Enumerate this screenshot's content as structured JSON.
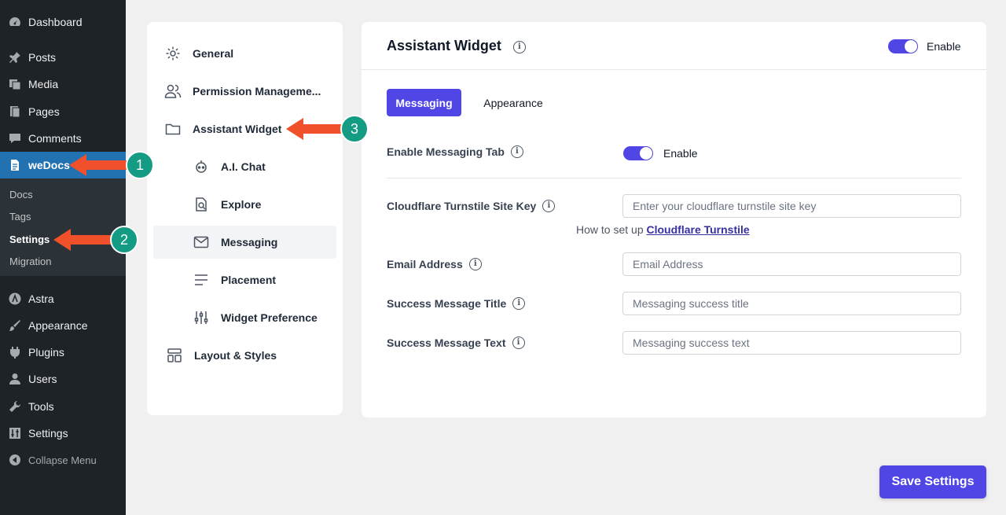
{
  "wp_menu": {
    "items": [
      {
        "label": "Dashboard",
        "icon": "dashboard-icon"
      },
      {
        "label": "Posts",
        "icon": "pin-icon"
      },
      {
        "label": "Media",
        "icon": "media-icon"
      },
      {
        "label": "Pages",
        "icon": "pages-icon"
      },
      {
        "label": "Comments",
        "icon": "comment-icon"
      },
      {
        "label": "weDocs",
        "icon": "document-icon"
      },
      {
        "label": "Astra",
        "icon": "astra-icon"
      },
      {
        "label": "Appearance",
        "icon": "brush-icon"
      },
      {
        "label": "Plugins",
        "icon": "plug-icon"
      },
      {
        "label": "Users",
        "icon": "user-icon"
      },
      {
        "label": "Tools",
        "icon": "wrench-icon"
      },
      {
        "label": "Settings",
        "icon": "sliders-icon"
      },
      {
        "label": "Collapse Menu",
        "icon": "collapse-icon"
      }
    ],
    "submenu": [
      "Docs",
      "Tags",
      "Settings",
      "Migration"
    ]
  },
  "settings_nav": {
    "items": [
      {
        "label": "General",
        "icon": "gear-icon"
      },
      {
        "label": "Permission Manageme...",
        "icon": "users-icon"
      },
      {
        "label": "Assistant Widget",
        "icon": "folder-icon"
      },
      {
        "label": "A.I. Chat",
        "icon": "robot-icon"
      },
      {
        "label": "Explore",
        "icon": "search-doc-icon"
      },
      {
        "label": "Messaging",
        "icon": "mail-icon"
      },
      {
        "label": "Placement",
        "icon": "lines-icon"
      },
      {
        "label": "Widget Preference",
        "icon": "sliders-icon"
      },
      {
        "label": "Layout & Styles",
        "icon": "layout-icon"
      }
    ]
  },
  "card": {
    "title": "Assistant Widget",
    "enable_label": "Enable",
    "tabs": [
      "Messaging",
      "Appearance"
    ],
    "messaging_tab": {
      "label": "Enable Messaging Tab",
      "enable_label": "Enable"
    },
    "fields": [
      {
        "label": "Cloudflare Turnstile Site Key",
        "placeholder": "Enter your cloudflare turnstile site key"
      },
      {
        "label": "Email Address",
        "placeholder": "Email Address"
      },
      {
        "label": "Success Message Title",
        "placeholder": "Messaging success title"
      },
      {
        "label": "Success Message Text",
        "placeholder": "Messaging success text"
      }
    ],
    "helper_text": "How to set up",
    "helper_link": "Cloudflare Turnstile"
  },
  "save_label": "Save Settings",
  "annotations": [
    "1",
    "2",
    "3"
  ],
  "colors": {
    "accent": "#4f46e5",
    "wp_sidebar": "#1d2327",
    "wp_active": "#2271b1",
    "arrow": "#f0502a",
    "badge": "#139b84"
  }
}
